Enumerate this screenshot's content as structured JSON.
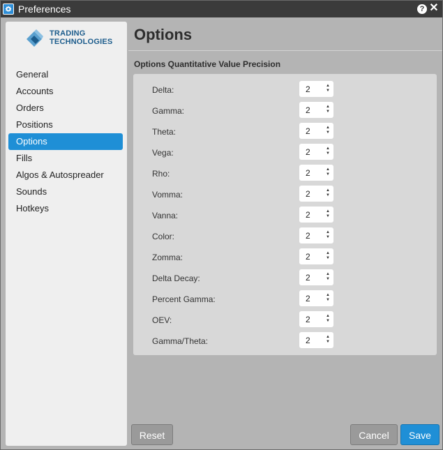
{
  "window": {
    "title": "Preferences",
    "help_icon": "?",
    "close_icon": "✕"
  },
  "brand": {
    "line1": "TRADING",
    "line2": "TECHNOLOGIES",
    "color": "#1c5c8c"
  },
  "sidebar": {
    "items": [
      {
        "label": "General"
      },
      {
        "label": "Accounts"
      },
      {
        "label": "Orders"
      },
      {
        "label": "Positions"
      },
      {
        "label": "Options",
        "active": true
      },
      {
        "label": "Fills"
      },
      {
        "label": "Algos & Autospreader"
      },
      {
        "label": "Sounds"
      },
      {
        "label": "Hotkeys"
      }
    ]
  },
  "main": {
    "title": "Options",
    "section_label": "Options Quantitative Value Precision",
    "rows": [
      {
        "label": "Delta:",
        "value": "2"
      },
      {
        "label": "Gamma:",
        "value": "2"
      },
      {
        "label": "Theta:",
        "value": "2"
      },
      {
        "label": "Vega:",
        "value": "2"
      },
      {
        "label": "Rho:",
        "value": "2"
      },
      {
        "label": "Vomma:",
        "value": "2"
      },
      {
        "label": "Vanna:",
        "value": "2"
      },
      {
        "label": "Color:",
        "value": "2"
      },
      {
        "label": "Zomma:",
        "value": "2"
      },
      {
        "label": "Delta Decay:",
        "value": "2"
      },
      {
        "label": "Percent Gamma:",
        "value": "2"
      },
      {
        "label": "OEV:",
        "value": "2"
      },
      {
        "label": "Gamma/Theta:",
        "value": "2"
      }
    ]
  },
  "footer": {
    "reset_label": "Reset",
    "cancel_label": "Cancel",
    "save_label": "Save"
  },
  "colors": {
    "accent": "#1f8fd6",
    "titlebar": "#3b3b3b"
  }
}
